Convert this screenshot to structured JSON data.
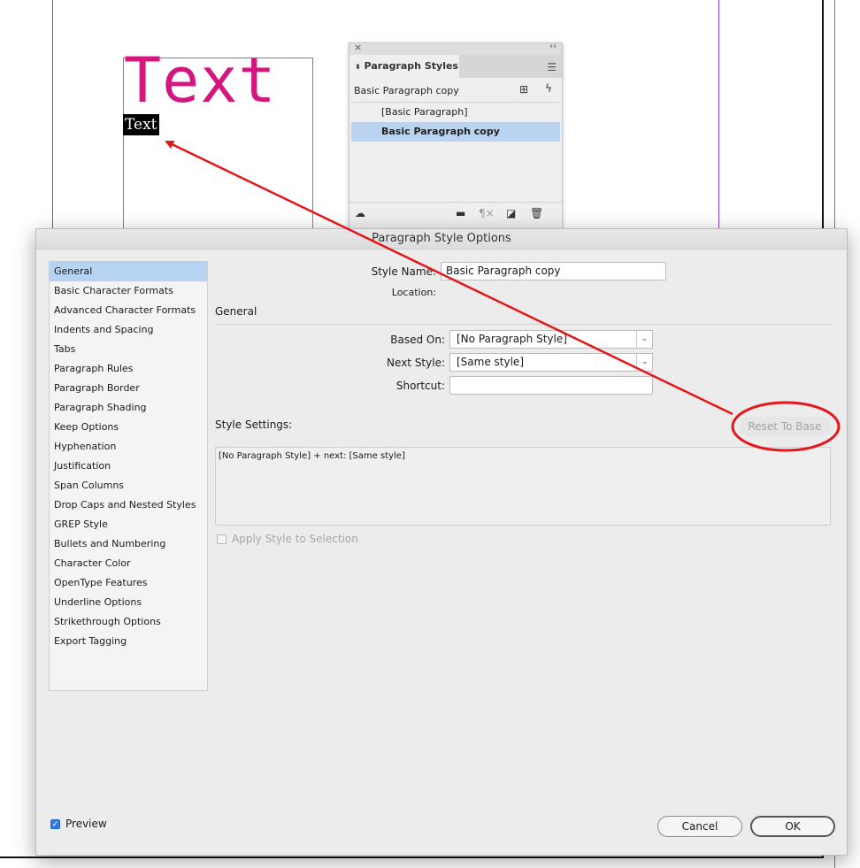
{
  "canvas": {
    "sample_text": "Text",
    "selected_text": "Text"
  },
  "panel": {
    "tab_label": "Paragraph Styles",
    "current_style": "Basic Paragraph copy",
    "styles": [
      {
        "label": "[Basic Paragraph]",
        "selected": false
      },
      {
        "label": "Basic Paragraph copy",
        "selected": true
      }
    ]
  },
  "dialog": {
    "title": "Paragraph Style Options",
    "categories": [
      "General",
      "Basic Character Formats",
      "Advanced Character Formats",
      "Indents and Spacing",
      "Tabs",
      "Paragraph Rules",
      "Paragraph Border",
      "Paragraph Shading",
      "Keep Options",
      "Hyphenation",
      "Justification",
      "Span Columns",
      "Drop Caps and Nested Styles",
      "GREP Style",
      "Bullets and Numbering",
      "Character Color",
      "OpenType Features",
      "Underline Options",
      "Strikethrough Options",
      "Export Tagging"
    ],
    "selected_category": "General",
    "style_name_label": "Style Name:",
    "style_name_value": "Basic Paragraph copy",
    "location_label": "Location:",
    "section_title": "General",
    "based_on_label": "Based On:",
    "based_on_value": "[No Paragraph Style]",
    "next_style_label": "Next Style:",
    "next_style_value": "[Same style]",
    "shortcut_label": "Shortcut:",
    "shortcut_value": "",
    "style_settings_label": "Style Settings:",
    "reset_button": "Reset To Base",
    "style_settings_text": "[No Paragraph Style] + next: [Same style]",
    "apply_label": "Apply Style to Selection",
    "preview_label": "Preview",
    "preview_checked": true,
    "cancel_button": "Cancel",
    "ok_button": "OK"
  },
  "annotation": {
    "color": "#e5161a"
  }
}
